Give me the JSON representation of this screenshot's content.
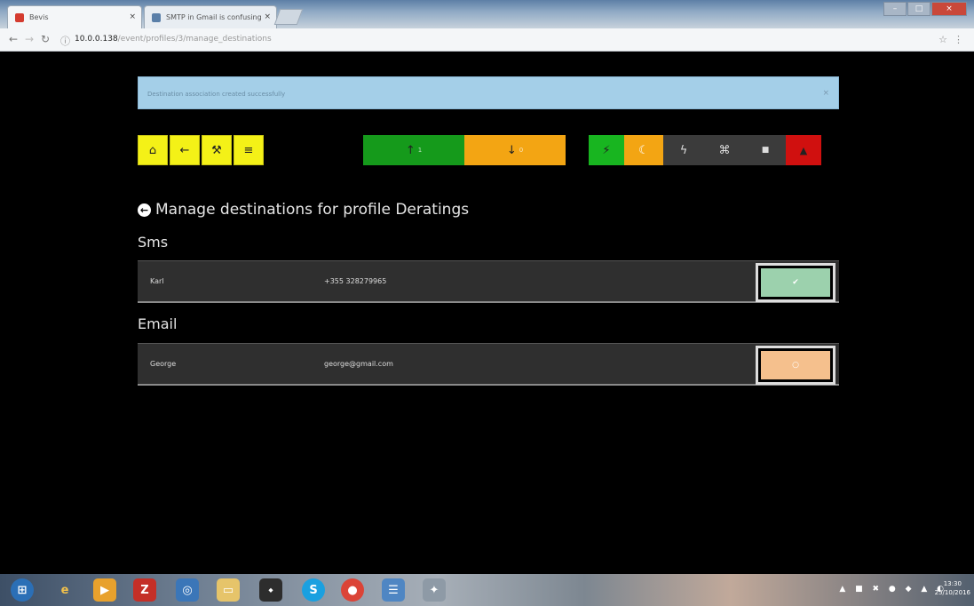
{
  "browser": {
    "tabs": [
      {
        "label": "Bevis",
        "active": true
      },
      {
        "label": "SMTP in Gmail is confusing",
        "active": false
      }
    ],
    "url_host": "10.0.0.138",
    "url_path": "/event/profiles/3/manage_destinations"
  },
  "alert": {
    "message": "Destination association created successfully",
    "close": "×"
  },
  "toolbar": {
    "nav_buttons": [
      {
        "icon": "home-icon",
        "glyph": "⌂"
      },
      {
        "icon": "arrow-left-icon",
        "glyph": "←"
      },
      {
        "icon": "wrench-icon",
        "glyph": "⚒"
      },
      {
        "icon": "list-icon",
        "glyph": "≡"
      }
    ],
    "counters": [
      {
        "icon": "arrow-up-icon",
        "glyph": "↑",
        "count": "1",
        "color": "#159a1b"
      },
      {
        "icon": "arrow-down-icon",
        "glyph": "↓",
        "count": "0",
        "color": "#f3a513"
      }
    ],
    "status_buttons": [
      {
        "icon": "plug-icon",
        "glyph": "⚡",
        "color": "#18b520"
      },
      {
        "icon": "moon-icon",
        "glyph": "☾",
        "color": "#f3a513"
      },
      {
        "icon": "bolt-icon",
        "glyph": "ϟ",
        "color": "#3b3b3b"
      },
      {
        "icon": "link-icon",
        "glyph": "⌘",
        "color": "#3b3b3b"
      },
      {
        "icon": "lock-icon",
        "glyph": "■",
        "color": "#3b3b3b"
      },
      {
        "icon": "warning-icon",
        "glyph": "▲",
        "color": "#d0100f"
      }
    ]
  },
  "heading": {
    "back_glyph": "←",
    "title": "Manage destinations for profile Deratings"
  },
  "sections": [
    {
      "title": "Sms",
      "row": {
        "name": "Karl",
        "contact": "+355 328279965",
        "toggle_state": "on",
        "toggle_color": "#9cd1ad",
        "toggle_glyph": "✔"
      }
    },
    {
      "title": "Email",
      "row": {
        "name": "George",
        "contact": "george@gmail.com",
        "toggle_state": "off",
        "toggle_color": "#f5c08d",
        "toggle_glyph": "○"
      }
    }
  ],
  "taskbar": {
    "apps": [
      "start-orb",
      "ie-icon",
      "media-player-icon",
      "filezilla-icon",
      "network-icon",
      "folder-icon",
      "usb-icon",
      "skype-icon",
      "chrome-icon",
      "explorer-icon",
      "tool-icon"
    ],
    "clock_time": "13:30",
    "clock_date": "25/10/2016"
  }
}
